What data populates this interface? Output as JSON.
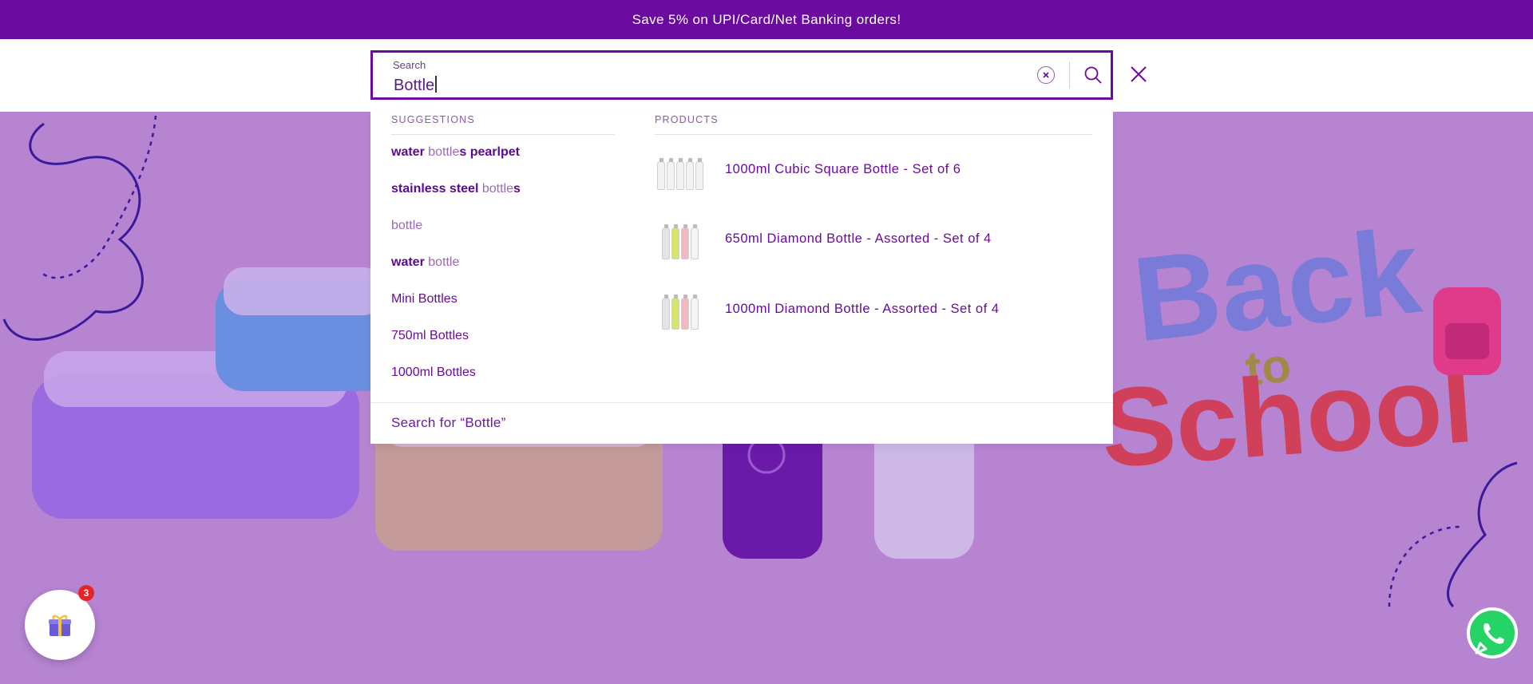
{
  "announcement": "Save 5% on UPI/Card/Net Banking orders!",
  "search": {
    "label": "Search",
    "value": "Bottle"
  },
  "suggestions_heading": "SUGGESTIONS",
  "products_heading": "PRODUCTS",
  "suggestions": [
    {
      "bold1": "water",
      "lite": " bottle",
      "bold2": "s pearlpet"
    },
    {
      "bold1": "stainless steel",
      "lite": " bottle",
      "bold2": "s"
    },
    {
      "bold1": "",
      "lite": "bottle",
      "bold2": ""
    },
    {
      "bold1": "water",
      "lite": " bottle",
      "bold2": ""
    },
    {
      "plain": "Mini Bottles"
    },
    {
      "plain": "750ml Bottles"
    },
    {
      "plain": "1000ml Bottles"
    }
  ],
  "products": [
    {
      "title": "1000ml Cubic Square Bottle - Set of 6"
    },
    {
      "title": "650ml Diamond Bottle - Assorted - Set of 4"
    },
    {
      "title": "1000ml Diamond Bottle - Assorted - Set of 4"
    }
  ],
  "search_for": "Search for “Bottle”",
  "gift_badge_count": "3",
  "colors": {
    "brand": "#6a0a9e",
    "hero_bg": "#b784d2",
    "badge": "#e52424",
    "whatsapp": "#25d366"
  },
  "icons": [
    "clear-icon",
    "search-icon",
    "close-icon",
    "gift-icon",
    "whatsapp-icon"
  ]
}
